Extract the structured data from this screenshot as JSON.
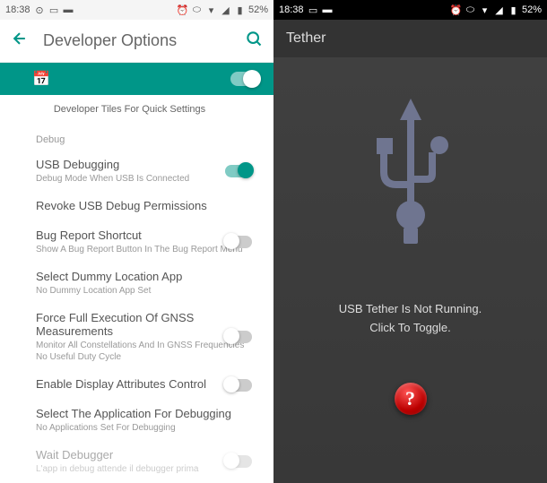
{
  "left": {
    "status": {
      "time": "18:38",
      "battery": "52%"
    },
    "header": {
      "title": "Developer Options"
    },
    "quick_tiles": "Developer Tiles For Quick Settings",
    "section_debug": "Debug",
    "items": {
      "usb_debug": {
        "title": "USB Debugging",
        "sub": "Debug Mode When USB Is Connected"
      },
      "revoke": {
        "title": "Revoke USB Debug Permissions"
      },
      "bug_report": {
        "title": "Bug Report Shortcut",
        "sub": "Show A Bug Report Button In The Bug Report Menu"
      },
      "dummy_loc": {
        "title": "Select Dummy Location App",
        "sub": "No Dummy Location App Set"
      },
      "gnss": {
        "title": "Force Full Execution Of GNSS Measurements",
        "sub": "Monitor All Constellations And In GNSS Frequencies No Useful Duty Cycle"
      },
      "display_attr": {
        "title": "Enable Display Attributes Control"
      },
      "debug_app": {
        "title": "Select The Application For Debugging",
        "sub": "No Applications Set For Debugging"
      },
      "wait_debug": {
        "title": "Wait Debugger",
        "sub": "L'app in debug attende il debugger prima"
      }
    }
  },
  "right": {
    "status": {
      "time": "18:38",
      "battery": "52%"
    },
    "header": {
      "title": "Tether"
    },
    "body": {
      "line1": "USB Tether Is Not Running.",
      "line2": "Click To Toggle."
    },
    "help": "?"
  }
}
